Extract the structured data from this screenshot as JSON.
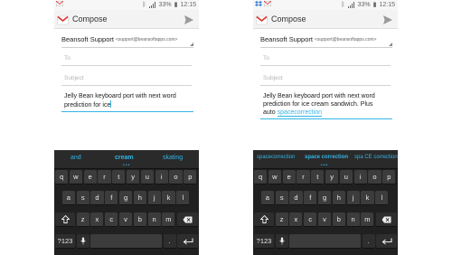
{
  "screens": [
    {
      "id": "left",
      "status": {
        "time": "12:15",
        "battery": "33%"
      },
      "title": "Compose",
      "from_name": "Beansoft Support",
      "from_email": "<support@beansoftapps.com>",
      "to_placeholder": "To",
      "subject_placeholder": "Subject",
      "body_lines": [
        "Jelly Bean keyboard port with next word",
        "prediction for ice"
      ],
      "suggestions": [
        "and",
        "cream",
        "skating"
      ]
    },
    {
      "id": "right",
      "status": {
        "time": "12:15",
        "battery": "33%"
      },
      "title": "Compose",
      "from_name": "Beansoft Support",
      "from_email": "<support@beansoftapps.com>",
      "to_placeholder": "To",
      "subject_placeholder": "Subject",
      "body_lines": [
        "Jelly Bean keyboard port with next word",
        "prediction for ice cream sandwich. Plus",
        "auto "
      ],
      "body_highlight": "spacecorrection",
      "suggestions": [
        "spacecorrection",
        "space correction",
        "spa CE correction"
      ]
    }
  ],
  "keyboard": {
    "row1": [
      "q",
      "w",
      "e",
      "r",
      "t",
      "y",
      "u",
      "i",
      "o",
      "p"
    ],
    "row2": [
      "a",
      "s",
      "d",
      "f",
      "g",
      "h",
      "j",
      "k",
      "l"
    ],
    "row3": [
      "z",
      "x",
      "c",
      "v",
      "b",
      "n",
      "m"
    ],
    "symbols_key": "?123",
    "period_key": ".",
    "icons": {
      "shift": "shift-icon",
      "backspace": "backspace-icon",
      "mic": "mic-icon",
      "enter": "enter-icon"
    }
  },
  "colors": {
    "accent": "#33b5e5",
    "keyboard_bg": "#202020",
    "key_bg": "#3c3c3c"
  }
}
